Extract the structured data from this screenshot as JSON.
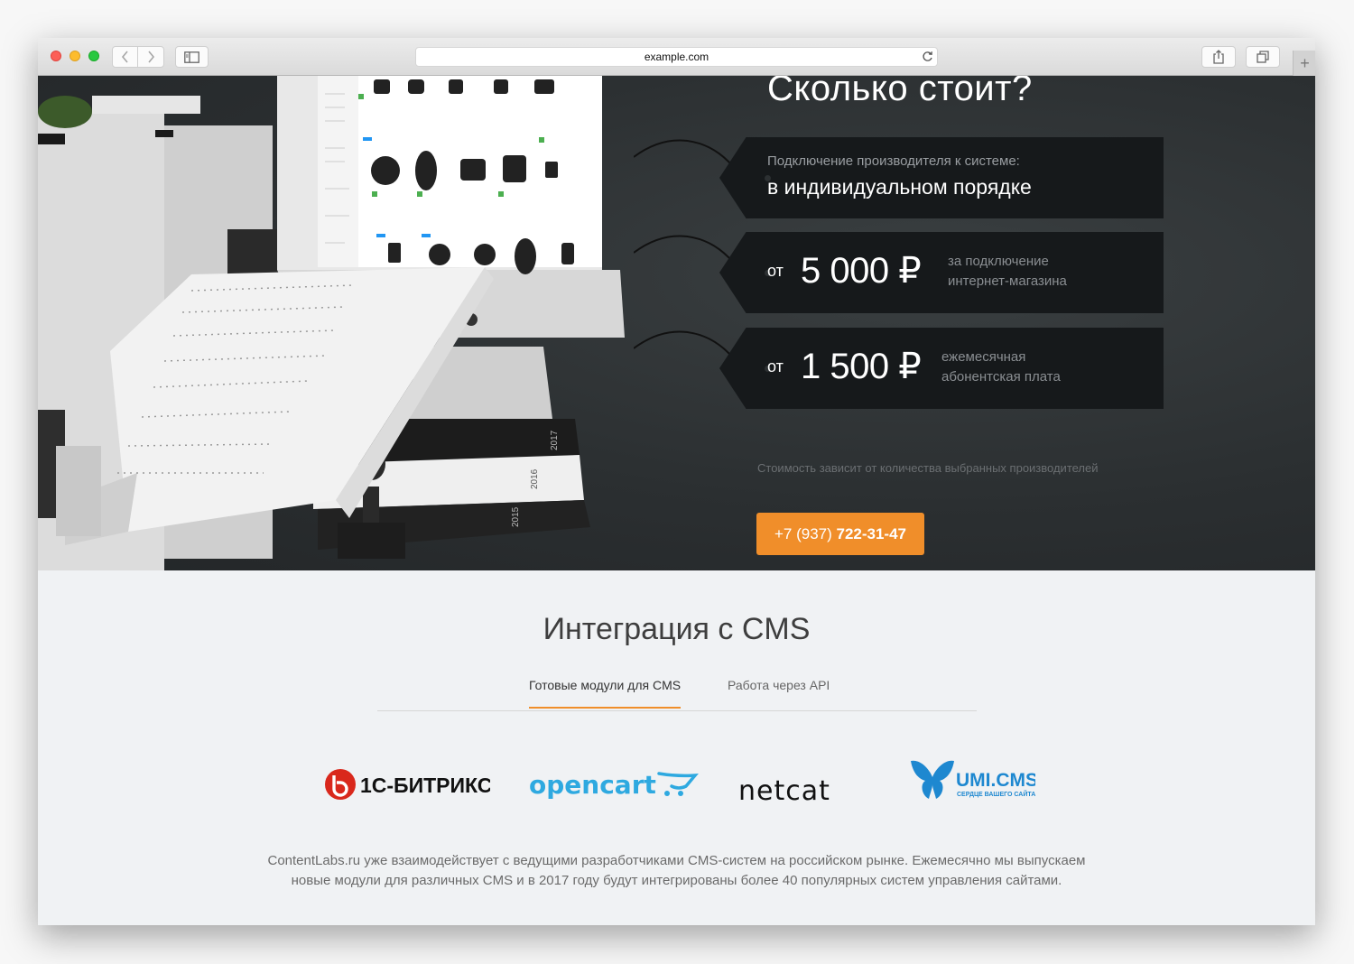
{
  "browser": {
    "url": "example.com"
  },
  "pricing": {
    "title": "Сколько стоит?",
    "tag1": {
      "small": "Подключение производителя к системе:",
      "big": "в индивидуальном порядке"
    },
    "tag2": {
      "prefix": "от",
      "amount": "5 000 ₽",
      "desc_line1": "за подключение",
      "desc_line2": "интернет-магазина"
    },
    "tag3": {
      "prefix": "от",
      "amount": "1 500 ₽",
      "desc_line1": "ежемесячная",
      "desc_line2": "абонентская плата"
    },
    "note": "Стоимость зависит от количества выбранных производителей",
    "phone_prefix": "+7 (937)",
    "phone_number": "722-31-47"
  },
  "illustration": {
    "book_spines": [
      "2017",
      "2016",
      "2015"
    ]
  },
  "cms": {
    "title": "Интеграция с CMS",
    "tabs": [
      "Готовые модули для CMS",
      "Работа через API"
    ],
    "active_tab": "Готовые модули для CMS",
    "logos": {
      "bitrix": "1С-БИТРИКС",
      "opencart": "opencart",
      "netcat": "netcat",
      "umi": "UMI.CMS",
      "umi_sub": "СЕРДЦЕ ВАШЕГО САЙТА"
    },
    "description": "ContentLabs.ru уже взаимодействует с ведущими разработчиками CMS-систем на российском рынке. Ежемесячно мы выпускаем новые модули для различных CMS и в 2017 году будут интегрированы более 40 популярных систем управления сайтами."
  },
  "colors": {
    "accent": "#f08e2a",
    "hero_bg": "#2b2f31",
    "tag_bg": "#16191b",
    "page_bg": "#f0f2f4"
  }
}
